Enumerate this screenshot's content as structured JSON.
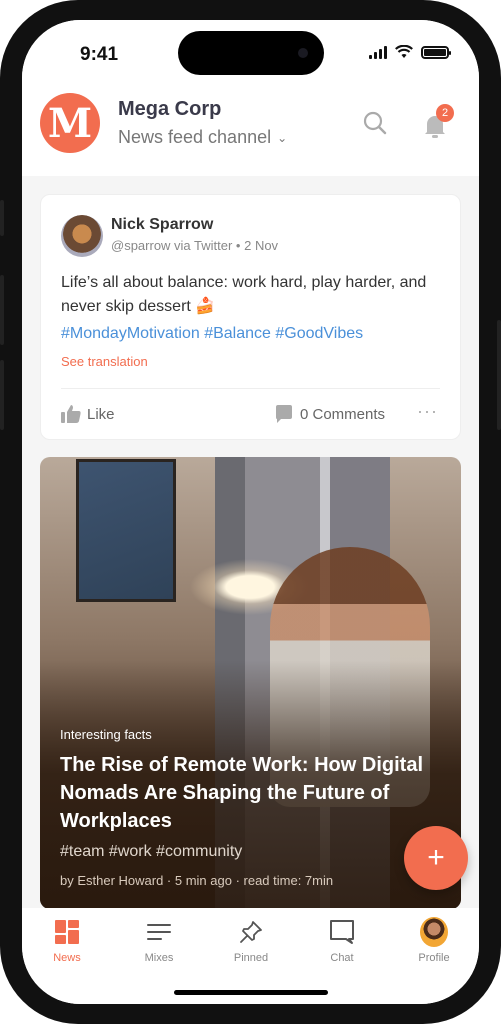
{
  "status_bar": {
    "time": "9:41"
  },
  "header": {
    "logo_letter": "M",
    "org_name": "Mega Corp",
    "channel": "News feed channel",
    "notification_count": "2"
  },
  "post": {
    "author": "Nick Sparrow",
    "handle_line": "@sparrow via Twitter • 2 Nov",
    "text": "Life’s all about balance: work hard, play harder, and never skip dessert 🍰",
    "hashtags": "#MondayMotivation #Balance #GoodVibes",
    "translate_label": "See translation",
    "like_label": "Like",
    "comments_label": "0 Comments",
    "more_label": "···"
  },
  "article": {
    "category": "Interesting facts",
    "title": "The Rise of Remote Work: How Digital Nomads Are Shaping the Future of Workplaces",
    "tags": "#team #work #community",
    "meta": "by Esther Howard · 5 min ago · read time: 7min"
  },
  "fab": {
    "label": "+"
  },
  "tabs": [
    {
      "label": "News",
      "icon": "grid-icon",
      "active": true
    },
    {
      "label": "Mixes",
      "icon": "lines-icon"
    },
    {
      "label": "Pinned",
      "icon": "pin-icon"
    },
    {
      "label": "Chat",
      "icon": "chat-icon"
    },
    {
      "label": "Profile",
      "icon": "avatar"
    }
  ],
  "colors": {
    "accent": "#f26d4f",
    "link": "#4a90d9",
    "text": "#333333"
  }
}
